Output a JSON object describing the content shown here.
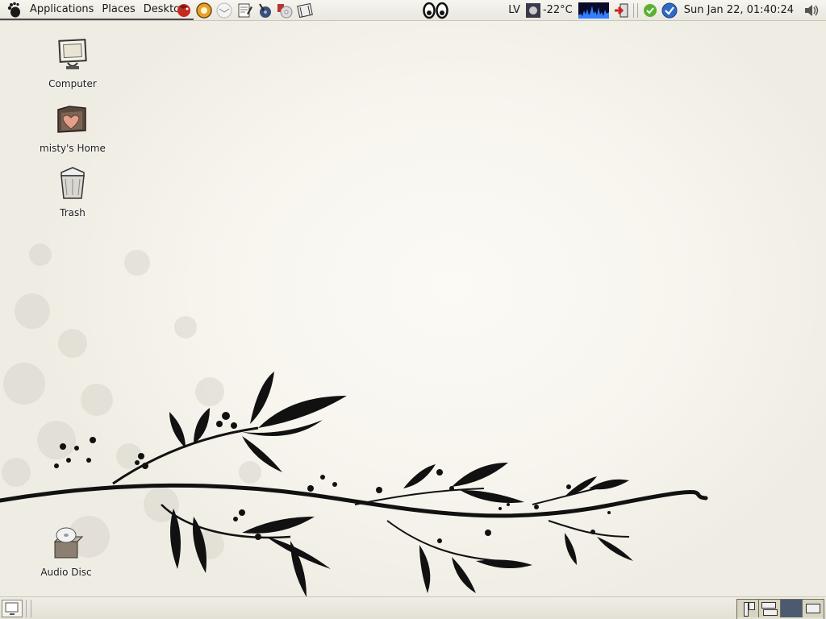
{
  "top_panel": {
    "menus": [
      "Applications",
      "Places",
      "Desktop"
    ],
    "launchers": [
      "firefox-icon",
      "gaim-icon",
      "mail-icon",
      "text-editor-icon",
      "media-player-icon",
      "cd-burner-icon",
      "movie-player-icon"
    ],
    "keyboard_layout": "LV",
    "weather": "-22°C",
    "clock": "Sun Jan 22, 01:40:24"
  },
  "desktop": {
    "icons": [
      {
        "label": "Computer"
      },
      {
        "label": "misty's Home"
      },
      {
        "label": "Trash"
      },
      {
        "label": "Audio Disc"
      }
    ]
  },
  "bottom_panel": {
    "workspace_count": 4,
    "active_workspace": 3
  },
  "colors": {
    "panel": "#ecebe3",
    "wallpaper": "#f7f5ee",
    "branch": "#111111",
    "active_workspace": "#4b5a6f"
  }
}
